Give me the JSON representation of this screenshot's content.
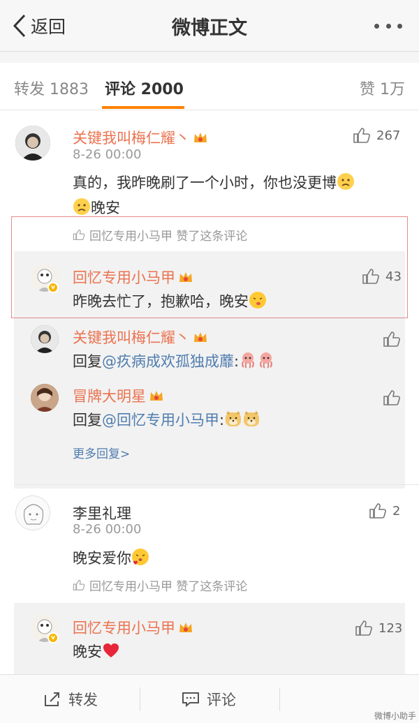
{
  "nav": {
    "back_label": "返回",
    "title": "微博正文"
  },
  "tabs": [
    {
      "label": "转发 1883"
    },
    {
      "label": "评论 2000"
    },
    {
      "label": "赞 1万"
    }
  ],
  "colors": {
    "accent": "#ff8200",
    "username": "#eb7350",
    "link": "#507daf",
    "highlight_border": "#e58a8a"
  },
  "comments": [
    {
      "user": "关键我叫梅仁耀丶",
      "time": "8-26 00:00",
      "likes": "267",
      "text_a": "真的，我昨晚刷了一个小时，你也没更博",
      "text_b": "晚安",
      "liked_by": "回忆专用小马甲 赞了这条评论",
      "highlight_reply": {
        "user": "回忆专用小马甲",
        "text": "昨晚去忙了，抱歉哈，晚安",
        "likes": "43"
      },
      "sub_replies": [
        {
          "user": "关键我叫梅仁耀丶",
          "prefix": "回复",
          "at": "@疚病成欢孤独成蘼",
          "suffix": ":"
        },
        {
          "user": "冒牌大明星",
          "prefix": "回复",
          "at": "@回忆专用小马甲",
          "suffix": ":"
        }
      ],
      "more_label": "更多回复>"
    },
    {
      "user": "李里礼理",
      "time": "8-26 00:00",
      "likes": "2",
      "text": "晚安爱你",
      "liked_by": "回忆专用小马甲 赞了这条评论",
      "highlight_reply": {
        "user": "回忆专用小马甲",
        "text": "晚安",
        "likes": "123"
      }
    }
  ],
  "bottom": {
    "repost_label": "转发",
    "comment_label": "评论"
  },
  "watermark": "微博小助手"
}
